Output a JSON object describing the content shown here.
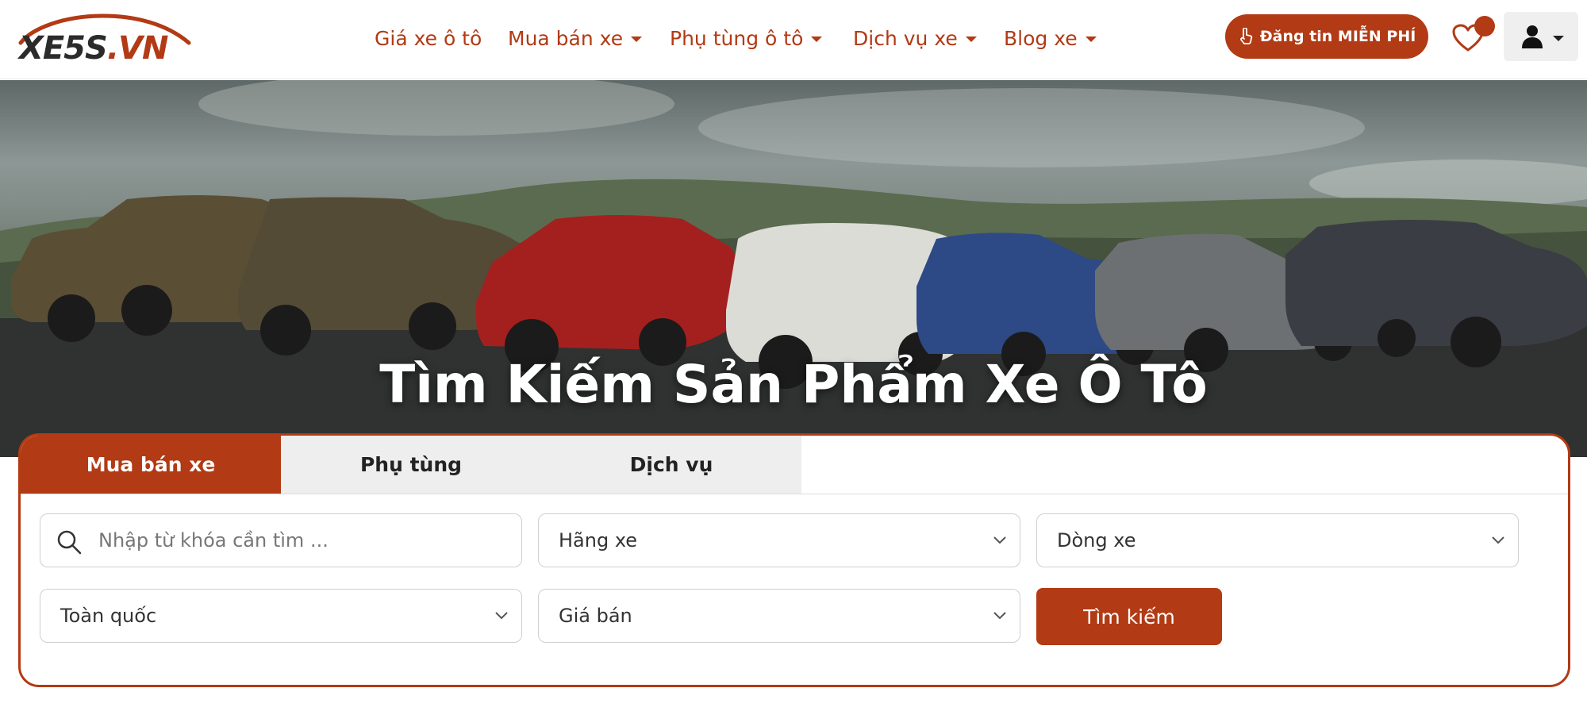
{
  "brand": {
    "logo_text_main": "XE5S",
    "logo_text_accent": ".VN",
    "accent_color": "#b23a14"
  },
  "nav": {
    "items": [
      {
        "label": "Giá xe ô tô",
        "dropdown": false
      },
      {
        "label": "Mua bán xe",
        "dropdown": true
      },
      {
        "label": "Phụ tùng ô tô",
        "dropdown": true
      },
      {
        "label": "Dịch vụ xe",
        "dropdown": true
      },
      {
        "label": "Blog xe",
        "dropdown": true
      }
    ]
  },
  "header_actions": {
    "post_button_label": "Đăng tin MIỄN PHÍ",
    "post_button_icon": "hand-pointer-icon",
    "favorite_icon": "heart-icon",
    "account_icon": "user-icon"
  },
  "hero": {
    "title": "Tìm Kiếm Sản Phẩm Xe Ô Tô"
  },
  "search": {
    "tabs": [
      {
        "label": "Mua bán xe",
        "active": true
      },
      {
        "label": "Phụ tùng",
        "active": false
      },
      {
        "label": "Dịch vụ",
        "active": false
      }
    ],
    "keyword_placeholder": "Nhập từ khóa cần tìm ...",
    "brand_select": "Hãng xe",
    "model_select": "Dòng xe",
    "region_select": "Toàn quốc",
    "price_select": "Giá bán",
    "submit_label": "Tìm kiếm"
  }
}
